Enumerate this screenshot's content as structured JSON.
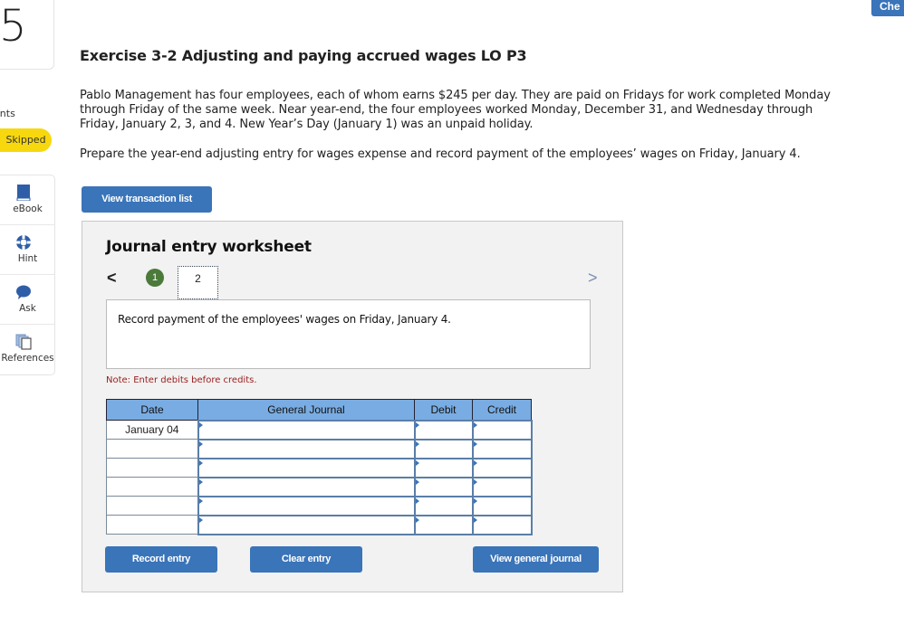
{
  "question": {
    "number": "5",
    "points_label": "oints",
    "status": "Skipped"
  },
  "tools": [
    {
      "icon": "book-icon",
      "label": "eBook"
    },
    {
      "icon": "lifebuoy-icon",
      "label": "Hint"
    },
    {
      "icon": "speech-bubble-icon",
      "label": "Ask"
    },
    {
      "icon": "documents-icon",
      "label": "References"
    }
  ],
  "header": {
    "check_label": "Che"
  },
  "exercise": {
    "title": "Exercise 3-2 Adjusting and paying accrued wages LO P3",
    "paragraph": "Pablo Management has four employees, each of whom earns $245 per day. They are paid on Fridays for work completed Monday through Friday of the same week. Near year-end, the four employees worked Monday, December 31, and Wednesday through Friday, January 2, 3, and 4. New Year’s Day (January 1) was an unpaid holiday.",
    "instruction": "Prepare the year-end adjusting entry for wages expense and record payment of the employees’ wages on Friday, January 4."
  },
  "buttons": {
    "view_transaction_list": "View transaction list",
    "record_entry": "Record entry",
    "clear_entry": "Clear entry",
    "view_general_journal": "View general journal"
  },
  "worksheet": {
    "title": "Journal entry worksheet",
    "prev": "<",
    "next": ">",
    "steps": [
      "1",
      "2"
    ],
    "current_step": 2,
    "description": "Record payment of the employees' wages on Friday, January 4.",
    "note": "Note: Enter debits before credits.",
    "table": {
      "headers": [
        "Date",
        "General Journal",
        "Debit",
        "Credit"
      ],
      "rows": [
        {
          "date": "January 04",
          "account": "",
          "debit": "",
          "credit": ""
        },
        {
          "date": "",
          "account": "",
          "debit": "",
          "credit": ""
        },
        {
          "date": "",
          "account": "",
          "debit": "",
          "credit": ""
        },
        {
          "date": "",
          "account": "",
          "debit": "",
          "credit": ""
        },
        {
          "date": "",
          "account": "",
          "debit": "",
          "credit": ""
        },
        {
          "date": "",
          "account": "",
          "debit": "",
          "credit": ""
        }
      ]
    }
  }
}
